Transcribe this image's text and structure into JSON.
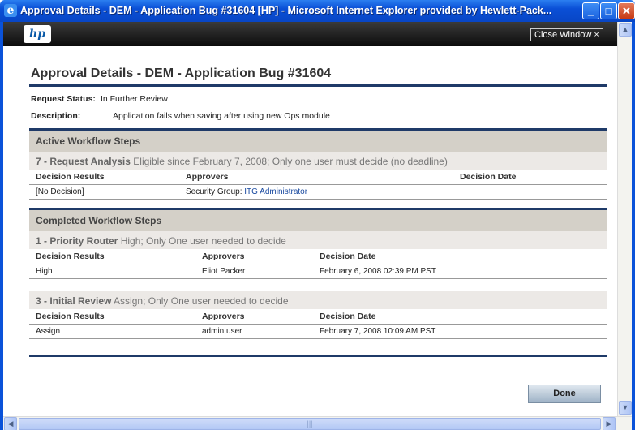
{
  "window": {
    "title": "Approval Details - DEM - Application Bug #31604 [HP] - Microsoft Internet Explorer provided by Hewlett-Pack...",
    "min_label": "_",
    "max_label": "□",
    "close_label": "✕"
  },
  "header": {
    "logo_text": "hp",
    "close_window_label": "Close Window ×"
  },
  "page": {
    "title": "Approval Details - DEM - Application Bug #31604",
    "request_status_label": "Request Status:",
    "request_status_value": "In Further Review",
    "description_label": "Description:",
    "description_value": "Application fails when saving after using new Ops module"
  },
  "active": {
    "heading": "Active Workflow Steps",
    "steps": [
      {
        "name": "7 - Request Analysis",
        "info": "Eligible since February 7, 2008; Only one user must decide (no deadline)",
        "columns": [
          "Decision Results",
          "Approvers",
          "Decision Date"
        ],
        "rows": [
          {
            "result": "[No Decision]",
            "approver_prefix": "Security Group: ",
            "approver_link": "ITG Administrator",
            "date": ""
          }
        ]
      }
    ]
  },
  "completed": {
    "heading": "Completed Workflow Steps",
    "steps": [
      {
        "name": "1 - Priority Router",
        "info": "High; Only One user needed to decide",
        "columns": [
          "Decision Results",
          "Approvers",
          "Decision Date"
        ],
        "rows": [
          {
            "result": "High",
            "approver": "Eliot Packer",
            "date": "February 6, 2008 02:39 PM PST"
          }
        ]
      },
      {
        "name": "3 - Initial Review",
        "info": "Assign; Only One user needed to decide",
        "columns": [
          "Decision Results",
          "Approvers",
          "Decision Date"
        ],
        "rows": [
          {
            "result": "Assign",
            "approver": "admin user",
            "date": "February 7, 2008 10:09 AM PST"
          }
        ]
      }
    ]
  },
  "actions": {
    "done_label": "Done"
  },
  "scroll": {
    "up": "▲",
    "down": "▼",
    "left": "◀",
    "right": "▶",
    "grip": "|||"
  }
}
